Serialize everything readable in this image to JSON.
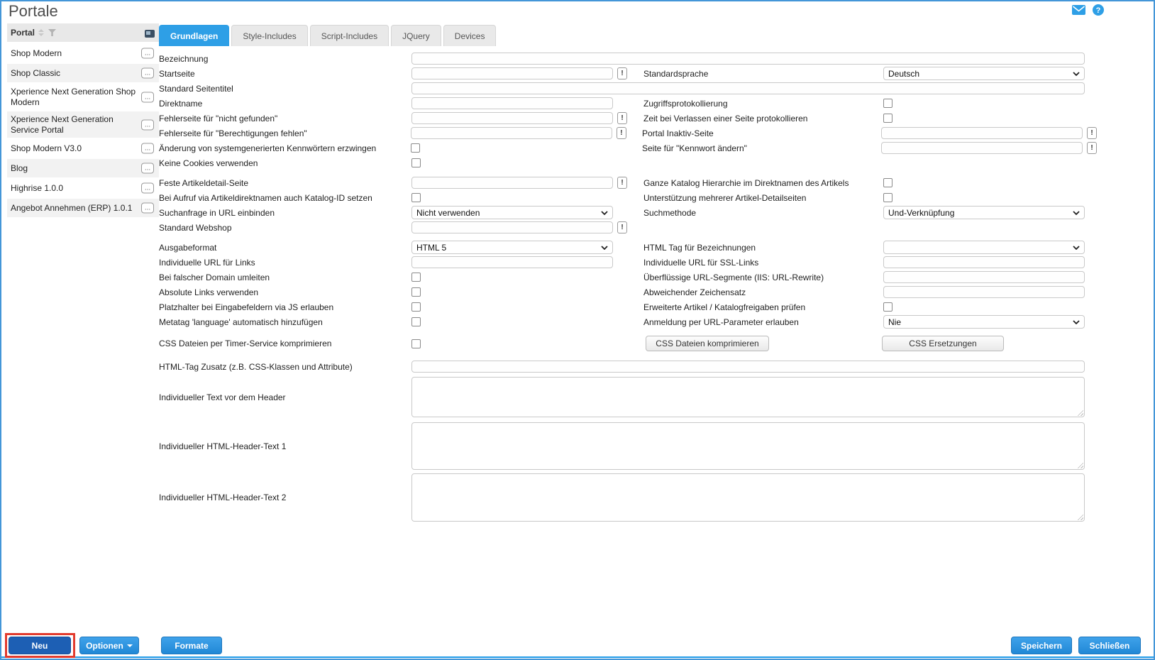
{
  "page": {
    "title": "Portale"
  },
  "colors": {
    "accent_blue": "#2e9fe6",
    "footer_button_blue": "#2188d6",
    "neu_button_blue": "#1d5fb4",
    "annotation_red": "#e23b2e",
    "bottom_line_blue": "#1f9ae8",
    "border_blue": "#4496d8"
  },
  "ui": {
    "warn_glyph": "!",
    "menu_glyph": "..."
  },
  "topbar": {
    "icons": [
      "mail-icon",
      "help-icon"
    ]
  },
  "sidebar": {
    "header": {
      "title": "Portal"
    },
    "items": [
      {
        "label": "Shop Modern"
      },
      {
        "label": "Shop Classic"
      },
      {
        "label": "Xperience Next Generation Shop Modern"
      },
      {
        "label": "Xperience Next Generation Service Portal"
      },
      {
        "label": "Shop Modern V3.0"
      },
      {
        "label": "Blog"
      },
      {
        "label": "Highrise 1.0.0"
      },
      {
        "label": "Angebot Annehmen (ERP) 1.0.1"
      }
    ]
  },
  "tabs": [
    {
      "label": "Grundlagen",
      "active": true
    },
    {
      "label": "Style-Includes",
      "active": false
    },
    {
      "label": "Script-Includes",
      "active": false
    },
    {
      "label": "JQuery",
      "active": false
    },
    {
      "label": "Devices",
      "active": false
    }
  ],
  "form": {
    "bezeichnung": {
      "label": "Bezeichnung",
      "value": ""
    },
    "startseite": {
      "label": "Startseite",
      "value": ""
    },
    "standardsprache": {
      "label": "Standardsprache",
      "value": "Deutsch"
    },
    "standard_seitentitel": {
      "label": "Standard Seitentitel",
      "value": ""
    },
    "direktname": {
      "label": "Direktname",
      "value": ""
    },
    "zugriffsprotokollierung": {
      "label": "Zugriffsprotokollierung",
      "checked": false
    },
    "fehlerseite_nicht_gefunden": {
      "label": "Fehlerseite für \"nicht gefunden\"",
      "value": ""
    },
    "zeit_bei_verlassen": {
      "label": "Zeit bei Verlassen einer Seite protokollieren",
      "checked": false
    },
    "fehlerseite_berechtigungen": {
      "label": "Fehlerseite für \"Berechtigungen fehlen\"",
      "value": ""
    },
    "portal_inaktiv_seite": {
      "label": "Portal Inaktiv-Seite",
      "value": ""
    },
    "kennwoerter_erzwingen": {
      "label": "Änderung von systemgenerierten Kennwörtern erzwingen",
      "checked": false
    },
    "seite_kennwort_aendern": {
      "label": "Seite für \"Kennwort ändern\"",
      "value": ""
    },
    "keine_cookies": {
      "label": "Keine Cookies verwenden",
      "checked": false
    },
    "feste_artikeldetail_seite": {
      "label": "Feste Artikeldetail-Seite",
      "value": ""
    },
    "ganze_katalog_hierarchie": {
      "label": "Ganze Katalog Hierarchie im Direktnamen des Artikels",
      "checked": false
    },
    "katalog_id_setzen": {
      "label": "Bei Aufruf via Artikeldirektnamen auch Katalog-ID setzen",
      "checked": false
    },
    "unterstuetzung_detailseiten": {
      "label": "Unterstützung mehrerer Artikel-Detailseiten",
      "checked": false
    },
    "suchanfrage_url": {
      "label": "Suchanfrage in URL einbinden",
      "value": "Nicht verwenden"
    },
    "suchmethode": {
      "label": "Suchmethode",
      "value": "Und-Verknüpfung"
    },
    "standard_webshop": {
      "label": "Standard Webshop",
      "value": ""
    },
    "ausgabeformat": {
      "label": "Ausgabeformat",
      "value": "HTML 5"
    },
    "html_tag_bezeichnungen": {
      "label": "HTML Tag für Bezeichnungen",
      "value": ""
    },
    "url_links": {
      "label": "Individuelle URL für Links",
      "value": ""
    },
    "url_ssl_links": {
      "label": "Individuelle URL für SSL-Links",
      "value": ""
    },
    "falsche_domain": {
      "label": "Bei falscher Domain umleiten",
      "checked": false
    },
    "url_segmente": {
      "label": "Überflüssige URL-Segmente (IIS: URL-Rewrite)",
      "value": ""
    },
    "absolute_links": {
      "label": "Absolute Links verwenden",
      "checked": false
    },
    "zeichensatz": {
      "label": "Abweichender Zeichensatz",
      "value": ""
    },
    "platzhalter_js": {
      "label": "Platzhalter bei Eingabefeldern via JS erlauben",
      "checked": false
    },
    "freigaben_pruefen": {
      "label": "Erweiterte Artikel / Katalogfreigaben prüfen",
      "checked": false
    },
    "metatag_language": {
      "label": "Metatag 'language' automatisch hinzufügen",
      "checked": false
    },
    "anmeldung_url_parameter": {
      "label": "Anmeldung per URL-Parameter erlauben",
      "value": "Nie"
    },
    "css_timer_service": {
      "label": "CSS Dateien per Timer-Service komprimieren",
      "checked": false
    },
    "css_komprimieren_button": "CSS Dateien komprimieren",
    "css_ersetzungen_button": "CSS Ersetzungen",
    "html_tag_zusatz": {
      "label": "HTML-Tag Zusatz (z.B. CSS-Klassen und Attribute)",
      "value": ""
    },
    "text_vor_header": {
      "label": "Individueller Text vor dem Header",
      "value": ""
    },
    "html_header_text_1": {
      "label": "Individueller HTML-Header-Text 1",
      "value": ""
    },
    "html_header_text_2": {
      "label": "Individueller HTML-Header-Text 2",
      "value": ""
    }
  },
  "footer": {
    "neu": "Neu",
    "optionen": "Optionen",
    "formate": "Formate",
    "speichern": "Speichern",
    "schliessen": "Schließen"
  }
}
